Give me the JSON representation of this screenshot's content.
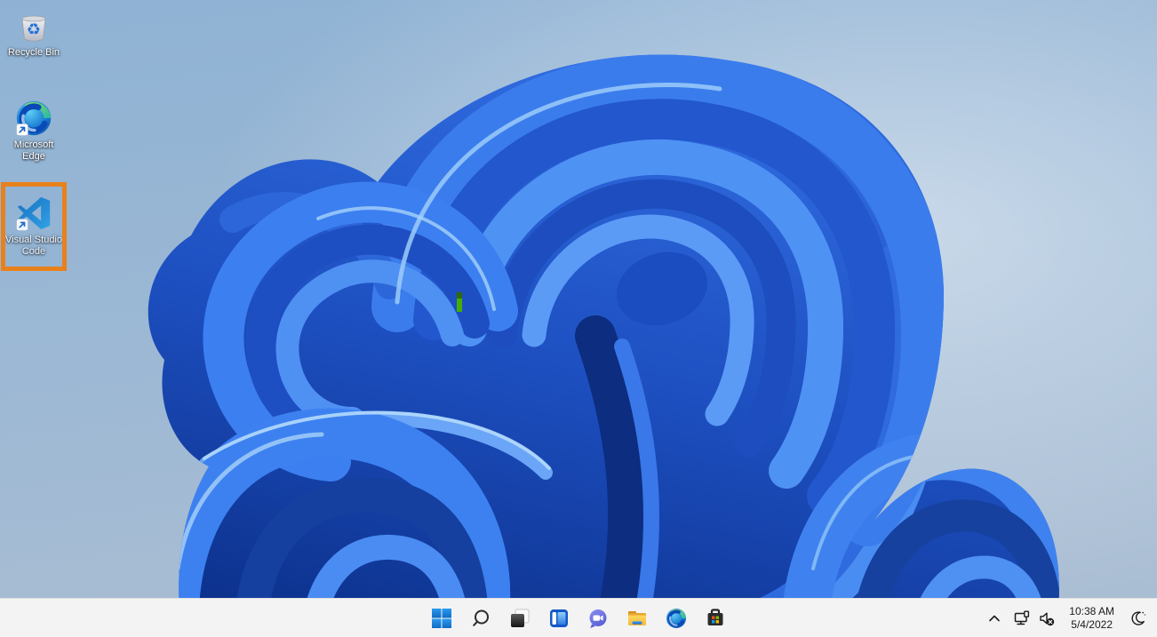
{
  "desktop": {
    "icons": [
      {
        "name": "recycle-bin",
        "lines": [
          "Recycle Bin",
          ""
        ]
      },
      {
        "name": "microsoft-edge",
        "lines": [
          "Microsoft",
          "Edge"
        ]
      },
      {
        "name": "visual-studio-code",
        "lines": [
          "Visual Studio",
          "Code"
        ],
        "highlighted": true
      }
    ],
    "selection_highlight_color": "#e8811c",
    "text_marker_color": "#46ad02"
  },
  "wallpaper": {
    "background_top": "#8fb2d4",
    "background_bottom": "#a9bdd3",
    "bloom_dark": "#0b2f86",
    "bloom_mid": "#2a63d8",
    "bloom_light": "#5b9bf6",
    "bloom_highlight": "#a8d2fa"
  },
  "taskbar": {
    "background": "#f3f3f3",
    "buttons": [
      {
        "name": "start"
      },
      {
        "name": "search"
      },
      {
        "name": "task-view"
      },
      {
        "name": "widgets"
      },
      {
        "name": "chat"
      },
      {
        "name": "file-explorer"
      },
      {
        "name": "microsoft-edge"
      },
      {
        "name": "microsoft-store"
      }
    ],
    "tray": {
      "icons": [
        "hidden-icons-chevron",
        "network",
        "volume-muted",
        "focus-assist-moon"
      ],
      "time": "10:38 AM",
      "date": "5/4/2022"
    }
  }
}
